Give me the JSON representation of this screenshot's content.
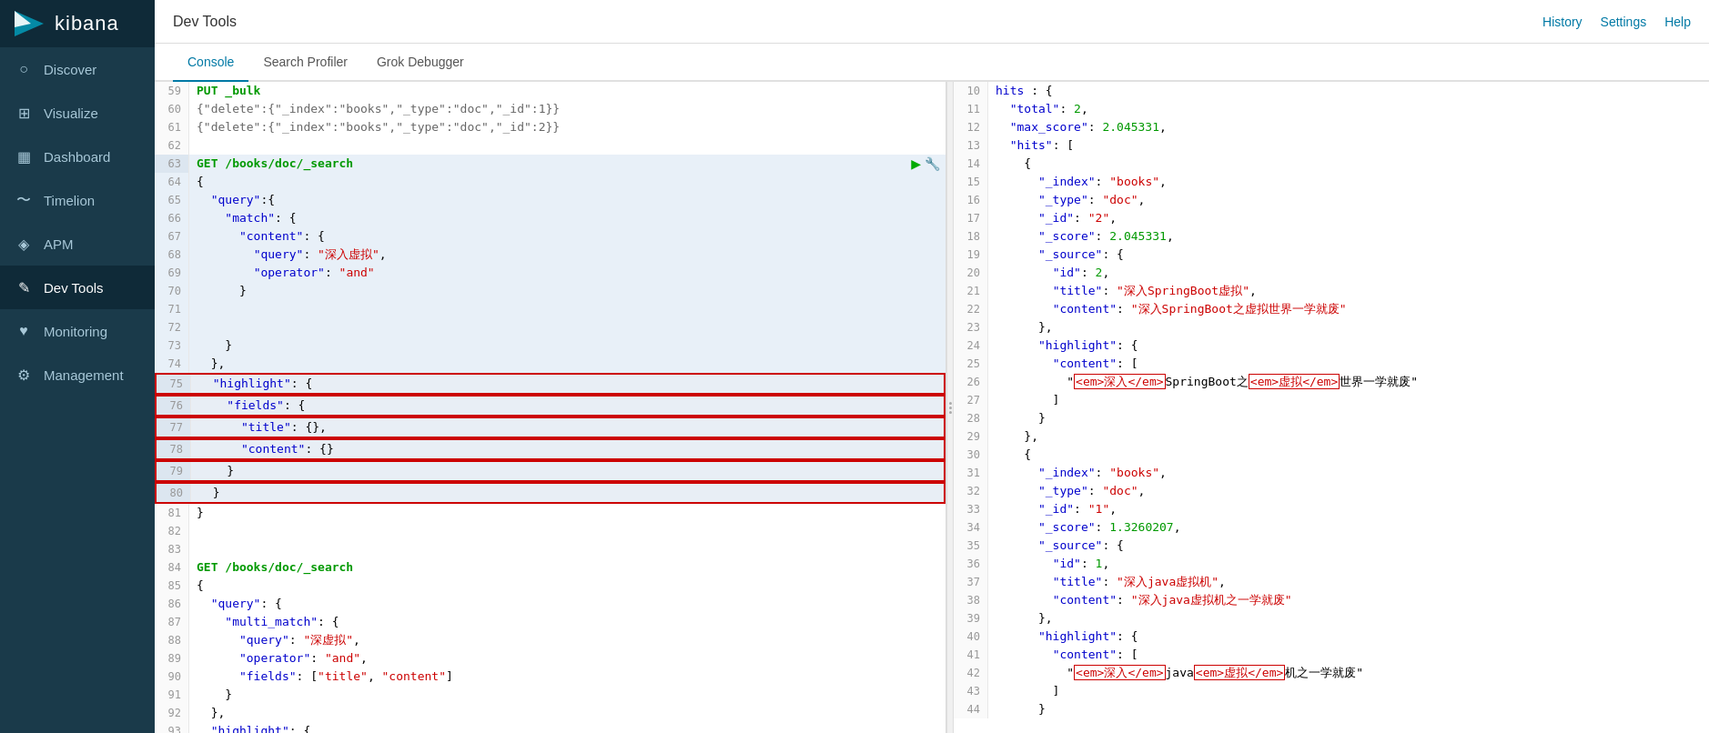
{
  "app": {
    "title": "Dev Tools"
  },
  "topbar": {
    "title": "Dev Tools",
    "history": "History",
    "settings": "Settings",
    "help": "Help"
  },
  "tabs": [
    {
      "label": "Console",
      "active": true
    },
    {
      "label": "Search Profiler",
      "active": false
    },
    {
      "label": "Grok Debugger",
      "active": false
    }
  ],
  "sidebar": {
    "logo": "kibana",
    "items": [
      {
        "label": "Discover",
        "icon": "○",
        "active": false
      },
      {
        "label": "Visualize",
        "icon": "⬚",
        "active": false
      },
      {
        "label": "Dashboard",
        "icon": "▦",
        "active": false
      },
      {
        "label": "Timelion",
        "icon": "~",
        "active": false
      },
      {
        "label": "APM",
        "icon": "◈",
        "active": false
      },
      {
        "label": "Dev Tools",
        "icon": "✎",
        "active": true
      },
      {
        "label": "Monitoring",
        "icon": "♥",
        "active": false
      },
      {
        "label": "Management",
        "icon": "⚙",
        "active": false
      }
    ]
  },
  "left_editor": {
    "lines": [
      {
        "num": "59",
        "content": "PUT _bulk",
        "type": "http"
      },
      {
        "num": "60",
        "content": "{\"delete\":{\"_index\":\"books\",\"_type\":\"doc\",\"_id\":1}}",
        "type": "code"
      },
      {
        "num": "61",
        "content": "{\"delete\":{\"_index\":\"books\",\"_type\":\"doc\",\"_id\":2}}",
        "type": "code"
      },
      {
        "num": "62",
        "content": "",
        "type": "blank"
      },
      {
        "num": "63",
        "content": "GET /books/doc/_search",
        "type": "http",
        "active": true
      },
      {
        "num": "64",
        "content": "{",
        "type": "code"
      },
      {
        "num": "65",
        "content": "  \"query\":{",
        "type": "code"
      },
      {
        "num": "66",
        "content": "    \"match\": {",
        "type": "code"
      },
      {
        "num": "67",
        "content": "      \"content\": {",
        "type": "code"
      },
      {
        "num": "68",
        "content": "        \"query\": \"深入虚拟\",",
        "type": "code"
      },
      {
        "num": "69",
        "content": "        \"operator\": \"and\"",
        "type": "code"
      },
      {
        "num": "70",
        "content": "      }",
        "type": "code"
      },
      {
        "num": "71",
        "content": "",
        "type": "blank"
      },
      {
        "num": "72",
        "content": "",
        "type": "blank"
      },
      {
        "num": "73",
        "content": "    }",
        "type": "code"
      },
      {
        "num": "74",
        "content": "  },",
        "type": "code"
      },
      {
        "num": "75",
        "content": "  \"highlight\": {",
        "type": "code",
        "highlight": true
      },
      {
        "num": "76",
        "content": "    \"fields\": {",
        "type": "code",
        "highlight": true
      },
      {
        "num": "77",
        "content": "      \"title\": {},",
        "type": "code",
        "highlight": true
      },
      {
        "num": "78",
        "content": "      \"content\": {}",
        "type": "code",
        "highlight": true
      },
      {
        "num": "79",
        "content": "    }",
        "type": "code",
        "highlight": true
      },
      {
        "num": "80",
        "content": "  }",
        "type": "code",
        "highlight": true
      },
      {
        "num": "81",
        "content": "}",
        "type": "code"
      },
      {
        "num": "82",
        "content": "",
        "type": "blank"
      },
      {
        "num": "83",
        "content": "",
        "type": "blank"
      },
      {
        "num": "84",
        "content": "GET /books/doc/_search",
        "type": "http"
      },
      {
        "num": "85",
        "content": "{",
        "type": "code"
      },
      {
        "num": "86",
        "content": "  \"query\": {",
        "type": "code"
      },
      {
        "num": "87",
        "content": "    \"multi_match\": {",
        "type": "code"
      },
      {
        "num": "88",
        "content": "      \"query\": \"深虚拟\",",
        "type": "code"
      },
      {
        "num": "89",
        "content": "      \"operator\": \"and\",",
        "type": "code"
      },
      {
        "num": "90",
        "content": "      \"fields\": [\"title\", \"content\"]",
        "type": "code"
      },
      {
        "num": "91",
        "content": "    }",
        "type": "code"
      },
      {
        "num": "92",
        "content": "  },",
        "type": "code"
      },
      {
        "num": "93",
        "content": "  \"highlight\": {",
        "type": "code"
      }
    ]
  },
  "right_output": {
    "lines": [
      {
        "num": "10",
        "content": "hits : {"
      },
      {
        "num": "11",
        "content": "  \"total\": 2,"
      },
      {
        "num": "12",
        "content": "  \"max_score\": 2.045331,"
      },
      {
        "num": "13",
        "content": "  \"hits\": ["
      },
      {
        "num": "14",
        "content": "    {"
      },
      {
        "num": "15",
        "content": "      \"_index\": \"books\","
      },
      {
        "num": "16",
        "content": "      \"_type\": \"doc\","
      },
      {
        "num": "17",
        "content": "      \"_id\": \"2\","
      },
      {
        "num": "18",
        "content": "      \"_score\": 2.045331,"
      },
      {
        "num": "19",
        "content": "      \"_source\": {"
      },
      {
        "num": "20",
        "content": "        \"id\": 2,"
      },
      {
        "num": "21",
        "content": "        \"title\": \"深入SpringBoot虚拟\","
      },
      {
        "num": "22",
        "content": "        \"content\": \"深入SpringBoot之虚拟世界一学就废\""
      },
      {
        "num": "23",
        "content": "      },"
      },
      {
        "num": "24",
        "content": "      \"highlight\": {"
      },
      {
        "num": "25",
        "content": "        \"content\": ["
      },
      {
        "num": "26",
        "content": "          \"<em>深入</em>SpringBoot之<em>虚拟</em>世界一学就废\""
      },
      {
        "num": "27",
        "content": "        ]"
      },
      {
        "num": "28",
        "content": "      }"
      },
      {
        "num": "29",
        "content": "    },"
      },
      {
        "num": "30",
        "content": "    {"
      },
      {
        "num": "31",
        "content": "      \"_index\": \"books\","
      },
      {
        "num": "32",
        "content": "      \"_type\": \"doc\","
      },
      {
        "num": "33",
        "content": "      \"_id\": \"1\","
      },
      {
        "num": "34",
        "content": "      \"_score\": 1.3260207,"
      },
      {
        "num": "35",
        "content": "      \"_source\": {"
      },
      {
        "num": "36",
        "content": "        \"id\": 1,"
      },
      {
        "num": "37",
        "content": "        \"title\": \"深入java虚拟机\","
      },
      {
        "num": "38",
        "content": "        \"content\": \"深入java虚拟机之一学就废\""
      },
      {
        "num": "39",
        "content": "      },"
      },
      {
        "num": "40",
        "content": "      \"highlight\": {"
      },
      {
        "num": "41",
        "content": "        \"content\": ["
      },
      {
        "num": "42",
        "content": "          \"<em>深入</em>java<em>虚拟</em>机之一学就废\""
      },
      {
        "num": "43",
        "content": "        ]"
      },
      {
        "num": "44",
        "content": "      }"
      }
    ]
  }
}
